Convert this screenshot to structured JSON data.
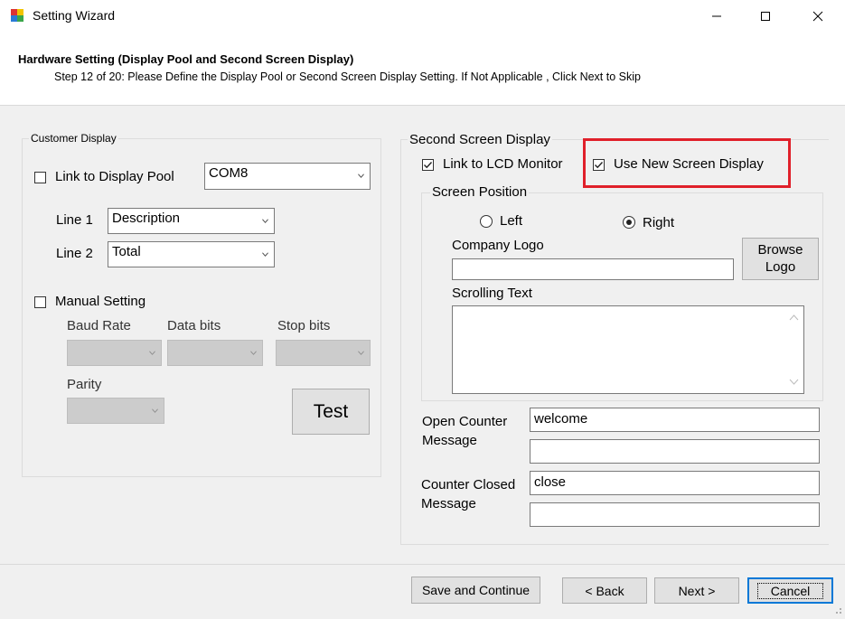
{
  "window": {
    "title": "Setting Wizard"
  },
  "header": {
    "title": "Hardware Setting (Display Pool and Second Screen Display)",
    "subtitle": "Step 12 of 20: Please Define the Display Pool or Second Screen Display Setting. If Not Applicable , Click Next to Skip"
  },
  "customer_display": {
    "legend": "Customer Display",
    "link_pool": {
      "label": "Link to Display Pool",
      "checked": false
    },
    "com_port": "COM8",
    "line1": {
      "label": "Line 1",
      "value": "Description"
    },
    "line2": {
      "label": "Line 2",
      "value": "Total"
    },
    "manual": {
      "label": "Manual Setting",
      "checked": false
    },
    "baud_label": "Baud Rate",
    "data_bits_label": "Data bits",
    "stop_bits_label": "Stop bits",
    "parity_label": "Parity",
    "test_label": "Test"
  },
  "second_screen": {
    "legend": "Second Screen Display",
    "link_lcd": {
      "label": "Link to LCD Monitor",
      "checked": true
    },
    "use_new": {
      "label": "Use New Screen Display",
      "checked": true
    },
    "position_legend": "Screen Position",
    "left_label": "Left",
    "right_label": "Right",
    "selected_position": "Right",
    "company_logo_label": "Company Logo",
    "company_logo_value": "",
    "browse_logo_label": "Browse Logo",
    "scrolling_text_label": "Scrolling Text",
    "scrolling_text_value": "",
    "open_counter_label": "Open Counter Message",
    "open_counter_value1": "welcome",
    "open_counter_value2": "",
    "closed_counter_label": "Counter Closed Message",
    "closed_counter_value1": "close",
    "closed_counter_value2": "",
    "highlight_color": "#e0202a"
  },
  "footer": {
    "save_continue": "Save and Continue",
    "back": "< Back",
    "next": "Next >",
    "cancel": "Cancel"
  }
}
